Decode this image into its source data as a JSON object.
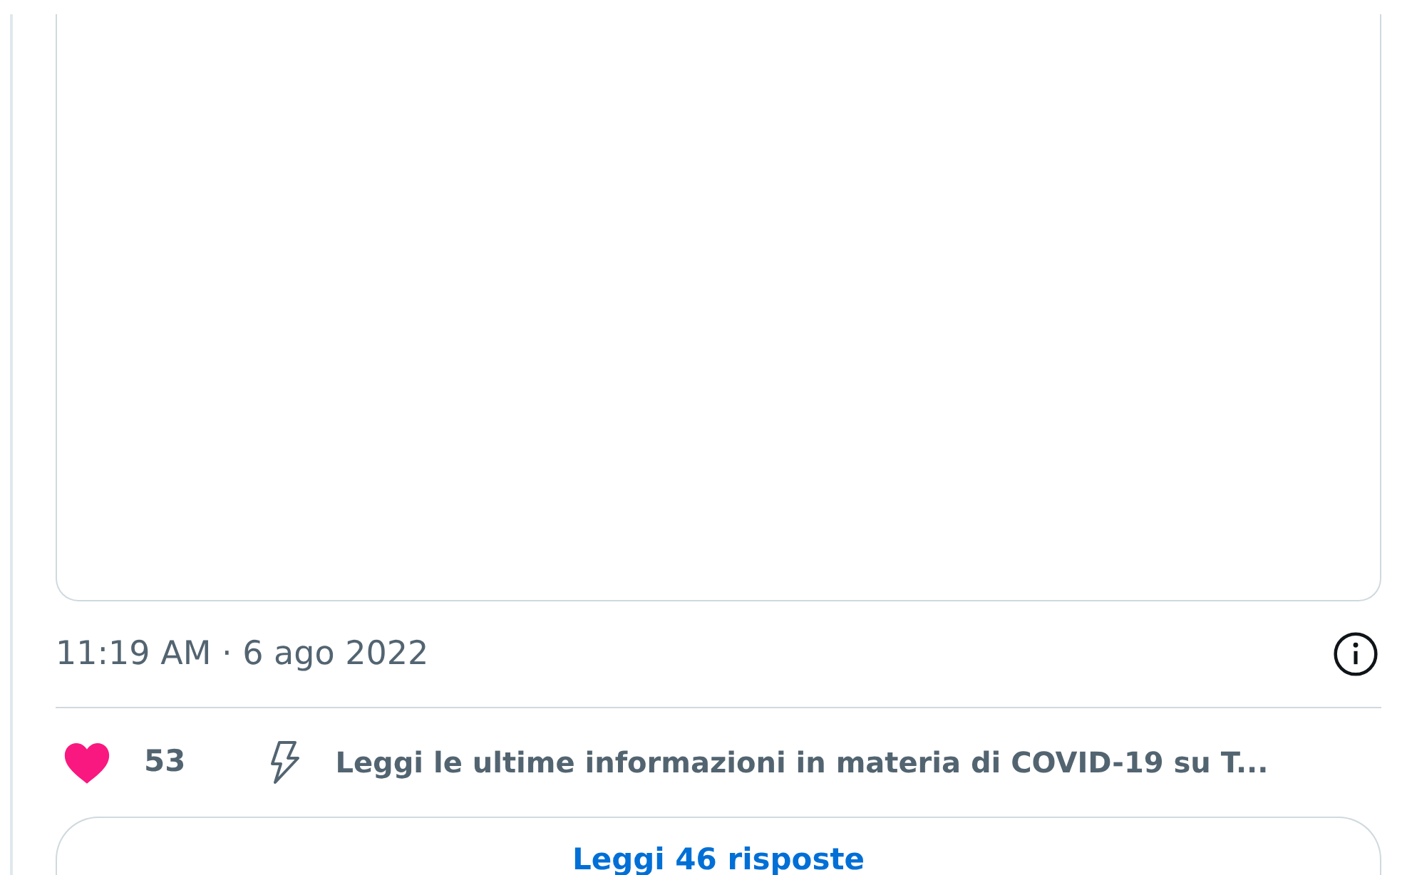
{
  "timestamp": "11:19 AM · 6 ago 2022",
  "likes": "53",
  "notice": "Leggi le ultime informazioni in materia di COVID-19 su T...",
  "replies_button": "Leggi 46 risposte"
}
